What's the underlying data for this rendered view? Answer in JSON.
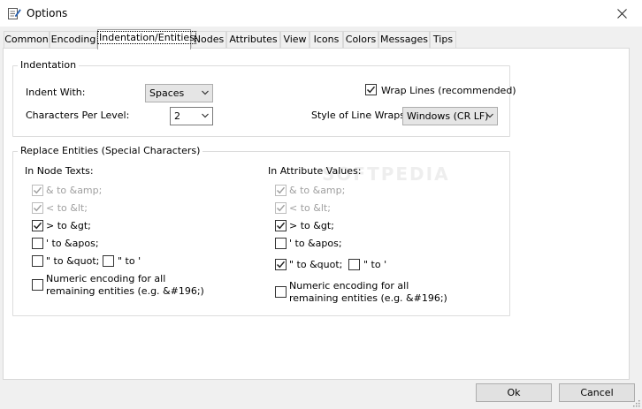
{
  "window": {
    "title": "Options"
  },
  "tabs": [
    {
      "label": "Common"
    },
    {
      "label": "Encoding"
    },
    {
      "label": "Indentation/Entities"
    },
    {
      "label": "Nodes"
    },
    {
      "label": "Attributes"
    },
    {
      "label": "View"
    },
    {
      "label": "Icons"
    },
    {
      "label": "Colors"
    },
    {
      "label": "Messages"
    },
    {
      "label": "Tips"
    }
  ],
  "indentation": {
    "group_label": "Indentation",
    "indent_with_label": "Indent With:",
    "indent_with_value": "Spaces",
    "chars_per_level_label": "Characters Per Level:",
    "chars_per_level_value": "2",
    "wrap_lines_label": "Wrap Lines (recommended)",
    "wrap_lines_checked": true,
    "line_wrap_style_label": "Style of Line Wraps:",
    "line_wrap_style_value": "Windows (CR LF)"
  },
  "entities": {
    "group_label": "Replace Entities (Special Characters)",
    "node_texts": {
      "header": "In Node Texts:",
      "amp": "& to &amp;",
      "lt": "< to &lt;",
      "gt": "> to &gt;",
      "apos": "' to &apos;",
      "quot": "\" to &quot;",
      "quot_alt": "\" to '",
      "numeric_line1": "Numeric encoding for all",
      "numeric_line2": "remaining entities (e.g. &#196;)"
    },
    "attr_values": {
      "header": "In Attribute Values:",
      "amp": "& to &amp;",
      "lt": "< to &lt;",
      "gt": "> to &gt;",
      "apos": "' to &apos;",
      "quot": "\" to &quot;",
      "quot_alt": "\" to '",
      "numeric_line1": "Numeric encoding for all",
      "numeric_line2": "remaining entities (e.g. &#196;)"
    }
  },
  "buttons": {
    "ok": "Ok",
    "cancel": "Cancel"
  },
  "watermark": "SOFTPEDIA"
}
